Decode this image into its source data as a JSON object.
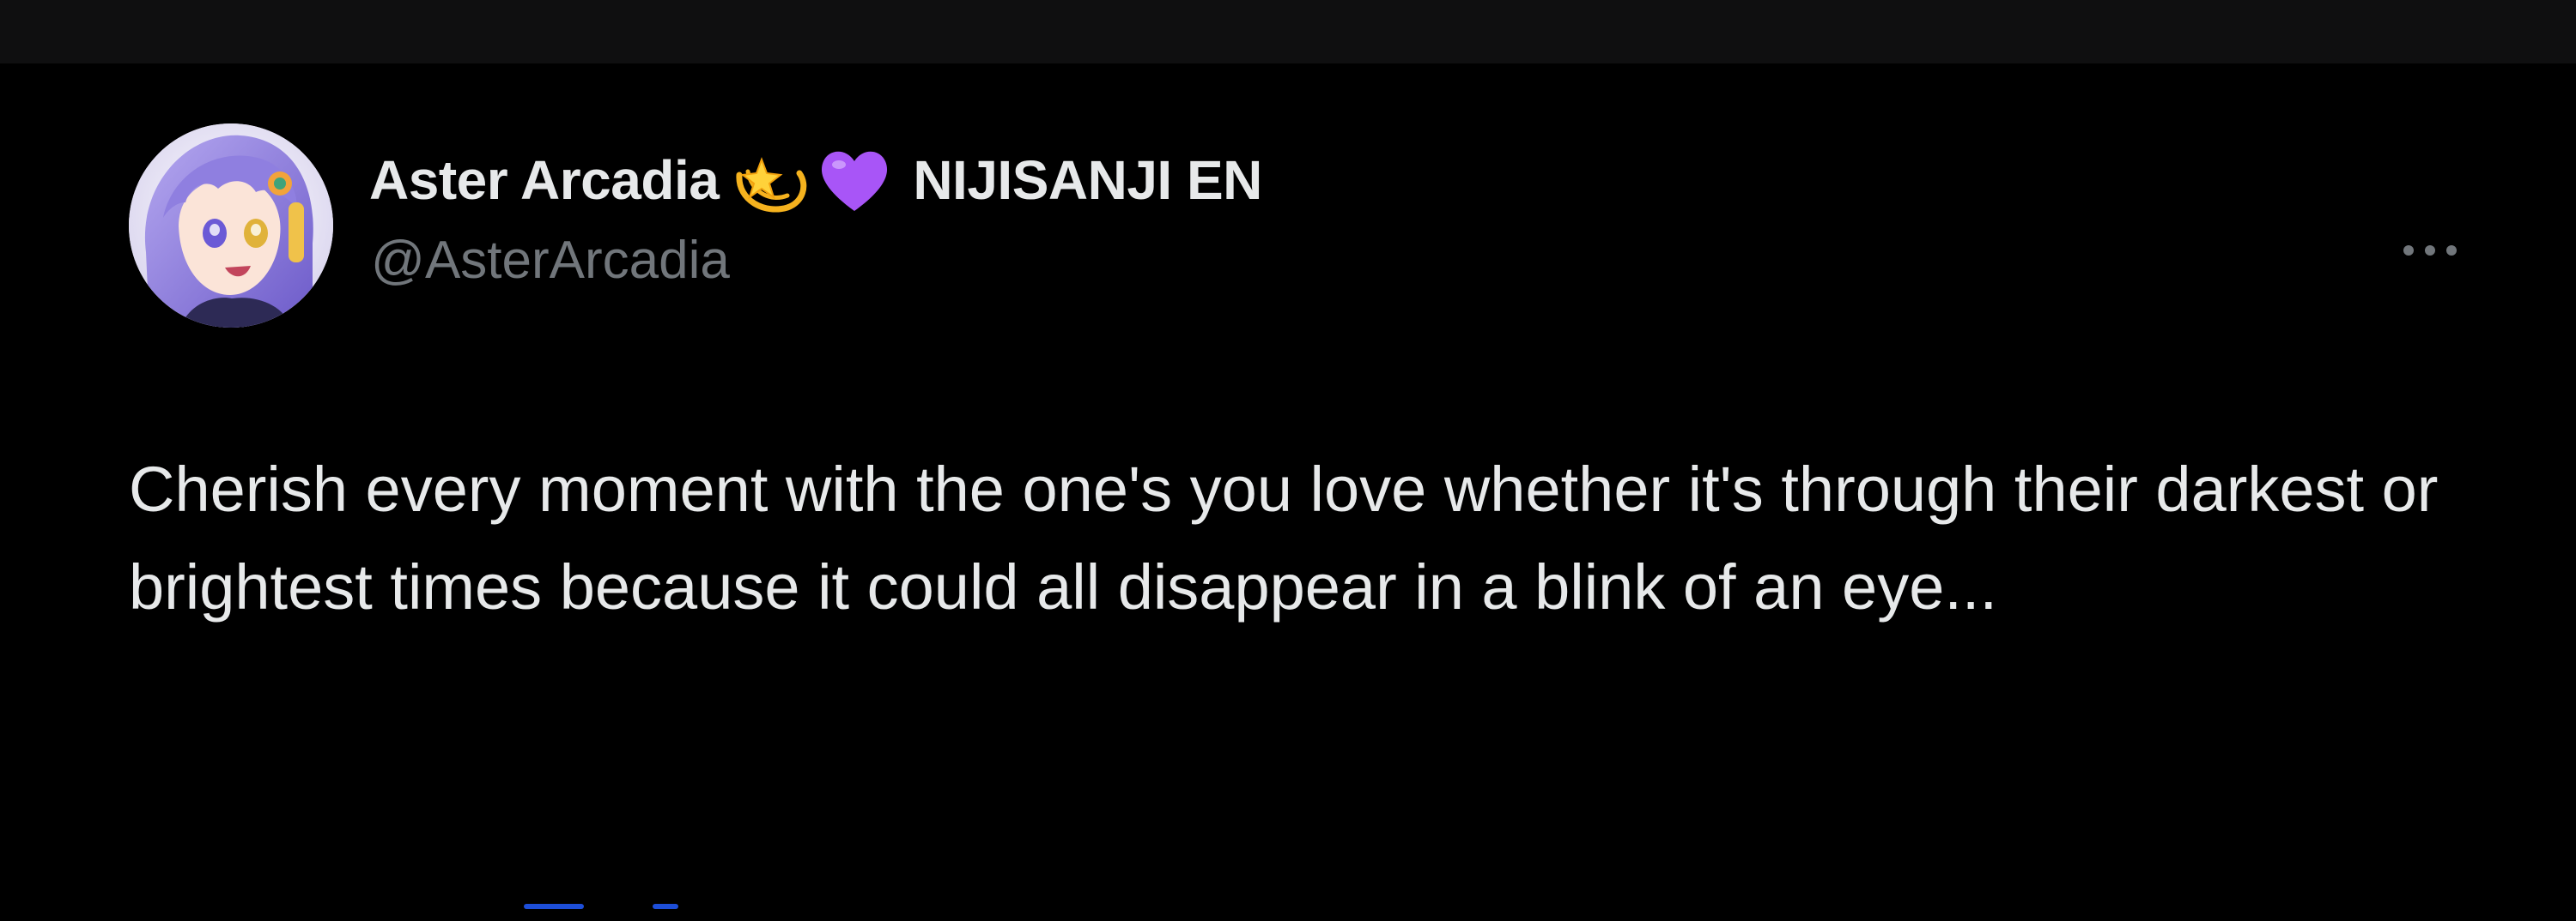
{
  "post": {
    "author": {
      "display_name": "Aster Arcadia",
      "emoji": [
        "dizzy-star-emoji",
        "purple-heart-emoji"
      ],
      "affiliation": "NIJISANJI EN",
      "handle": "@AsterArcadia"
    },
    "text": "Cherish every moment with the one's you love whether it's through their darkest or brightest times because it could all disappear in a blink of an eye...",
    "more_icon": "more-horizontal-icon"
  },
  "colors": {
    "background": "#000000",
    "top_bar": "#0f0f10",
    "primary_text": "#e7e9ea",
    "secondary_text": "#71767b",
    "purple_heart": "#a855f7",
    "link_blue": "#1d4ed8"
  }
}
